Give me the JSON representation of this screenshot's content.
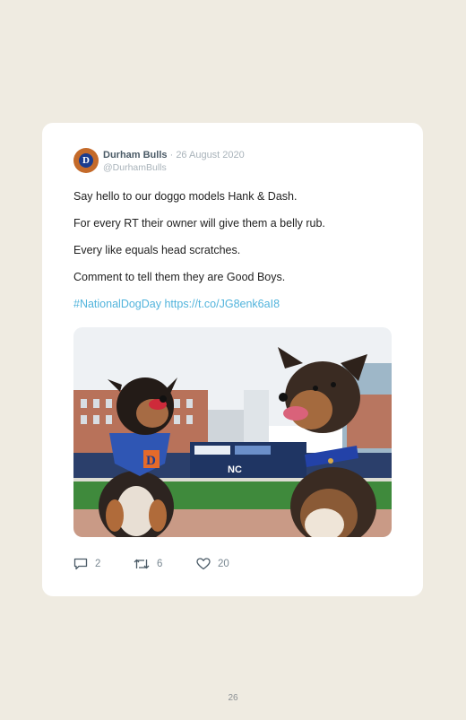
{
  "tweet": {
    "author_name": "Durham Bulls",
    "separator": "·",
    "date": "26 August 2020",
    "handle": "@DurhamBulls",
    "avatar_letter": "D",
    "lines": [
      "Say hello to our doggo models Hank & Dash.",
      "For every RT their owner will give them a belly rub.",
      "Every like equals head scratches.",
      "Comment to tell them they are Good Boys."
    ],
    "hashtag": "#NationalDogDay",
    "link": "https://t.co/JG8enk6aI8",
    "replies": "2",
    "retweets": "6",
    "likes": "20"
  },
  "photo": {
    "scoreboard_text": "NC"
  },
  "page_number": "26",
  "colors": {
    "page_bg": "#efebe1",
    "card_bg": "#ffffff",
    "link": "#52b4dc",
    "muted": "#a9b3ba"
  }
}
